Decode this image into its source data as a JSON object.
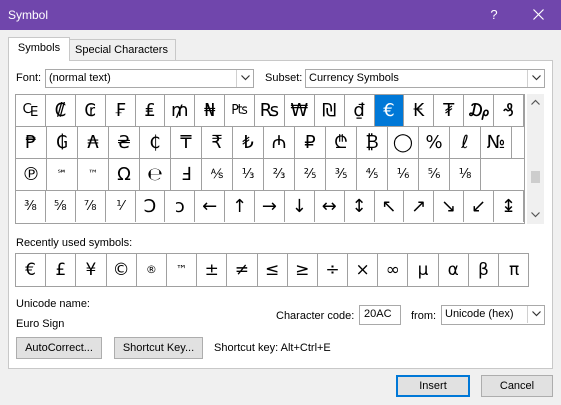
{
  "window": {
    "title": "Symbol",
    "help_label": "?"
  },
  "tabs": [
    {
      "label": "Symbols",
      "active": true
    },
    {
      "label": "Special Characters",
      "active": false
    }
  ],
  "font": {
    "label": "Font:",
    "value": "(normal text)"
  },
  "subset": {
    "label": "Subset:",
    "value": "Currency Symbols"
  },
  "symbols": [
    [
      "₠",
      "₡",
      "₢",
      "₣",
      "₤",
      "₥",
      "₦",
      "₧",
      "₨",
      "₩",
      "₪",
      "₫",
      "€",
      "₭",
      "₮",
      "₯",
      "₰"
    ],
    [
      "₱",
      "₲",
      "₳",
      "₴",
      "₵",
      "₸",
      "₹",
      "₺",
      "₼",
      "₽",
      "₾",
      "₿",
      "◯",
      "%",
      "ℓ",
      "№"
    ],
    [
      "℗",
      "℠",
      "™",
      "Ω",
      "℮",
      "Ⅎ",
      "⅍",
      "⅓",
      "⅔",
      "⅖",
      "⅗",
      "⅘",
      "⅙",
      "⅚",
      "⅛"
    ],
    [
      "⅜",
      "⅝",
      "⅞",
      "⅟",
      "Ↄ",
      "ↄ",
      "←",
      "↑",
      "→",
      "↓",
      "↔",
      "↕",
      "↖",
      "↗",
      "↘",
      "↙",
      "↨"
    ]
  ],
  "selected_symbol": "€",
  "recent": {
    "label": "Recently used symbols:",
    "items": [
      "€",
      "£",
      "¥",
      "©",
      "®",
      "™",
      "±",
      "≠",
      "≤",
      "≥",
      "÷",
      "×",
      "∞",
      "µ",
      "α",
      "β",
      "π"
    ]
  },
  "unicode_name": {
    "label": "Unicode name:",
    "value": "Euro Sign"
  },
  "character_code": {
    "label": "Character code:",
    "value": "20AC"
  },
  "from": {
    "label": "from:",
    "value": "Unicode (hex)"
  },
  "buttons": {
    "autocorrect": "AutoCorrect...",
    "shortcut_key": "Shortcut Key...",
    "insert": "Insert",
    "cancel": "Cancel"
  },
  "shortcut_key_text": "Shortcut key: Alt+Ctrl+E",
  "colors": {
    "titlebar": "#7046ac",
    "selection": "#0078d7"
  }
}
